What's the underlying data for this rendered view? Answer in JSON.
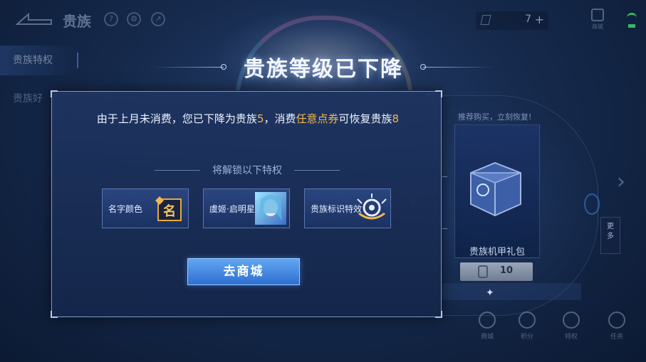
{
  "background": {
    "header": {
      "title": "贵族",
      "icons": [
        "question-icon",
        "gear-icon",
        "share-icon"
      ],
      "currency_value": "7",
      "currency_add": "+",
      "corner_label": "商城"
    },
    "sidebar": {
      "items": [
        {
          "label": "贵族特权",
          "active": true
        },
        {
          "label": "贵族好"
        }
      ]
    },
    "right_panel": {
      "hint": "推荐购买，立刻恢复!",
      "gift_name": "贵族机甲礼包",
      "price": "10",
      "strip_text": "",
      "more_label": "更\n多",
      "bottom_icons": [
        "商城",
        "积分",
        "特权",
        "任务"
      ]
    }
  },
  "modal": {
    "title": "贵族等级已下降",
    "message": {
      "part1": "由于上月未消费，您已下降为贵族",
      "level_now": "5",
      "part2": "，消费",
      "currency_name": "任意点券",
      "part3": "可恢复贵族",
      "level_restore": "8"
    },
    "unlock_label": "将解锁以下特权",
    "privileges": [
      {
        "label": "名字颜色",
        "icon": "name-color-icon"
      },
      {
        "label": "虞姬·启明星使",
        "icon": "skin-portrait-icon"
      },
      {
        "label": "贵族标识特效",
        "icon": "noble-emblem-icon"
      }
    ],
    "shop_button": "去商城"
  },
  "colors": {
    "accent": "#f3b84a",
    "button": "#3f83dc",
    "panel": "#1e3460",
    "border": "#7e95c2"
  }
}
